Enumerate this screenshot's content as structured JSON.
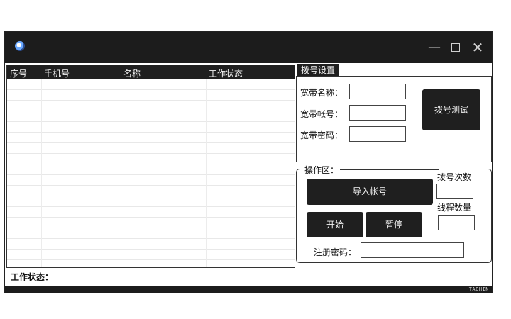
{
  "window": {
    "controls": {
      "minimize": "—",
      "maximize": "",
      "close": "✕"
    },
    "icons": {
      "app": "globe-icon",
      "minimize": "minimize-icon",
      "maximize": "maximize-icon",
      "close": "close-icon"
    }
  },
  "grid": {
    "columns": [
      "序号",
      "手机号",
      "名称",
      "工作状态"
    ],
    "rows": []
  },
  "status_label": "工作状态：",
  "dial_settings": {
    "tab": "拨号设置",
    "broadband_name_label": "宽带名称：",
    "broadband_account_label": "宽带帐号：",
    "broadband_password_label": "宽带密码：",
    "broadband_name_value": "",
    "broadband_account_value": "",
    "broadband_password_value": "",
    "test_button": "拨号测试"
  },
  "operation": {
    "legend": "操作区：",
    "import_button": "导入帐号",
    "start_button": "开始",
    "pause_button": "暂停",
    "dial_count_label": "拨号次数",
    "thread_count_label": "线程数量",
    "dial_count_value": "",
    "thread_count_value": "",
    "register_label": "注册密码：",
    "register_value": ""
  },
  "brand": "TAOHIN",
  "colors": {
    "dark": "#1c1c1c",
    "light_text": "#f2f2f2",
    "background": "#ffffff"
  }
}
